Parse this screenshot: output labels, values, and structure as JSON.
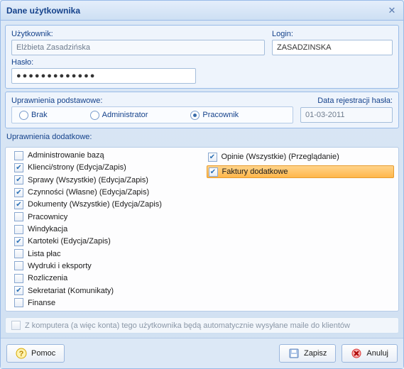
{
  "window": {
    "title": "Dane użytkownika"
  },
  "user": {
    "user_label": "Użytkownik:",
    "user_value": "Elżbieta Zasadzińska",
    "login_label": "Login:",
    "login_value": "ZASADZINSKA",
    "password_label": "Hasło:",
    "password_value": "●●●●●●●●●●●●●"
  },
  "basic": {
    "label": "Uprawnienia podstawowe:",
    "options": {
      "none": "Brak",
      "admin": "Administrator",
      "worker": "Pracownik"
    },
    "selected": "worker",
    "regdate_label": "Data rejestracji hasła:",
    "regdate_value": "01-03-2011"
  },
  "extra": {
    "label": "Uprawnienia dodatkowe:",
    "left": [
      {
        "label": "Administrowanie bazą",
        "checked": false
      },
      {
        "label": "Klienci/strony (Edycja/Zapis)",
        "checked": true
      },
      {
        "label": "Sprawy (Wszystkie) (Edycja/Zapis)",
        "checked": true
      },
      {
        "label": "Czynności (Własne) (Edycja/Zapis)",
        "checked": true
      },
      {
        "label": "Dokumenty (Wszystkie) (Edycja/Zapis)",
        "checked": true
      },
      {
        "label": "Pracownicy",
        "checked": false
      },
      {
        "label": "Windykacja",
        "checked": false
      },
      {
        "label": "Kartoteki (Edycja/Zapis)",
        "checked": true
      },
      {
        "label": "Lista płac",
        "checked": false
      },
      {
        "label": "Wydruki i eksporty",
        "checked": false
      },
      {
        "label": "Rozliczenia",
        "checked": false
      },
      {
        "label": "Sekretariat (Komunikaty)",
        "checked": true
      },
      {
        "label": "Finanse",
        "checked": false
      }
    ],
    "right": [
      {
        "label": "Opinie (Wszystkie) (Przeglądanie)",
        "checked": true,
        "highlight": false
      },
      {
        "label": "Faktury dodatkowe",
        "checked": true,
        "highlight": true
      }
    ]
  },
  "auto_mail": {
    "label": "Z komputera (a więc konta) tego użytkownika będą automatycznie wysyłane maile do klientów",
    "checked": false
  },
  "buttons": {
    "help": "Pomoc",
    "save": "Zapisz",
    "cancel": "Anuluj"
  }
}
